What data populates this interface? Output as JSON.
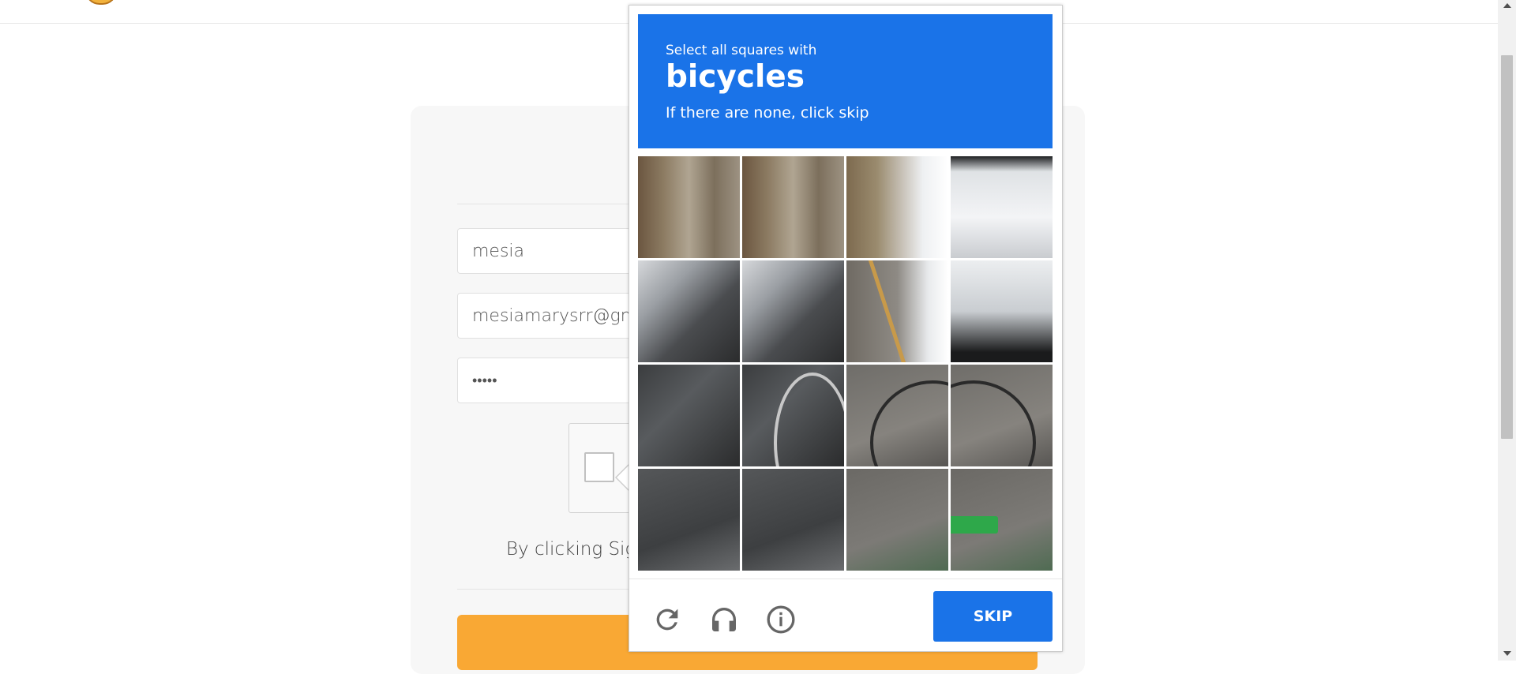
{
  "form": {
    "name_value": "mesia",
    "email_value": "mesiamarysrr@gm",
    "password_value": "•••••",
    "terms_text": "By clicking Sign"
  },
  "challenge": {
    "instruction_pre": "Select all squares with",
    "target_object": "bicycles",
    "instruction_post": "If there are none, click skip",
    "skip_label": "SKIP",
    "accent_color": "#1a73e8",
    "icons": [
      "reload-icon",
      "headphones-icon",
      "info-icon"
    ]
  },
  "signup": {
    "button_color": "#f9a834"
  }
}
